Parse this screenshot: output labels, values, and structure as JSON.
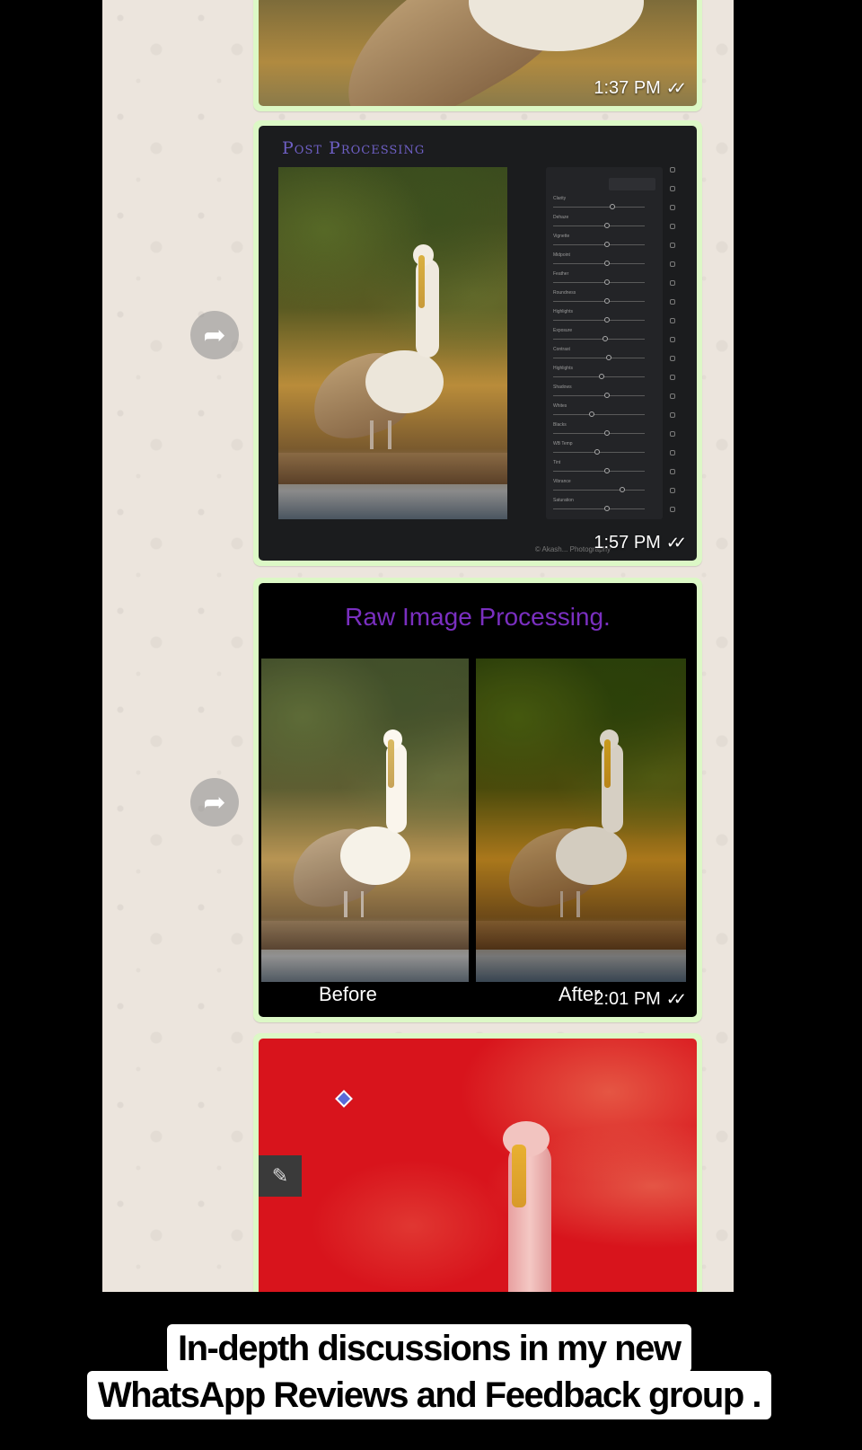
{
  "messages": [
    {
      "id": "msg-1",
      "time": "1:37 PM",
      "ticks": "✓✓"
    },
    {
      "id": "msg-2",
      "time": "1:57 PM",
      "ticks": "✓✓",
      "title": "Post Processing",
      "watermark": "© Akash... Photography",
      "sliders": [
        {
          "label": "Clarity",
          "pos": 0.55
        },
        {
          "label": "Dehaze",
          "pos": 0.5
        },
        {
          "label": "Vignette",
          "pos": 0.5
        },
        {
          "label": "Midpoint",
          "pos": 0.5
        },
        {
          "label": "Feather",
          "pos": 0.5
        },
        {
          "label": "Roundness",
          "pos": 0.5
        },
        {
          "label": "Highlights",
          "pos": 0.5
        },
        {
          "label": "Exposure",
          "pos": 0.48
        },
        {
          "label": "Contrast",
          "pos": 0.52
        },
        {
          "label": "Highlights",
          "pos": 0.45
        },
        {
          "label": "Shadows",
          "pos": 0.5
        },
        {
          "label": "Whites",
          "pos": 0.35
        },
        {
          "label": "Blacks",
          "pos": 0.5
        },
        {
          "label": "WB Temp",
          "pos": 0.4
        },
        {
          "label": "Tint",
          "pos": 0.5
        },
        {
          "label": "Vibrance",
          "pos": 0.65
        },
        {
          "label": "Saturation",
          "pos": 0.5
        }
      ]
    },
    {
      "id": "msg-3",
      "time": "2:01 PM",
      "ticks": "✓✓",
      "title": "Raw Image Processing.",
      "before_label": "Before",
      "after_label": "After"
    },
    {
      "id": "msg-4"
    }
  ],
  "icons": {
    "forward": "forward-arrow-icon",
    "brush": "brush-icon",
    "pin": "diamond-pin-icon"
  },
  "caption": {
    "line1": "In-depth discussions in my new",
    "line2": "WhatsApp Reviews and Feedback group ."
  }
}
